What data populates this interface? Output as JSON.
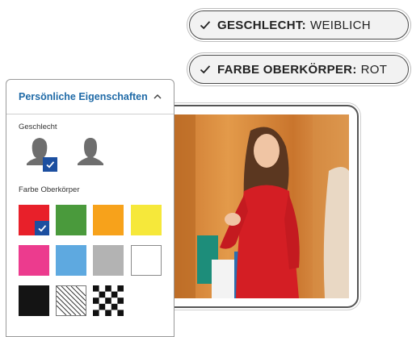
{
  "chips": [
    {
      "key": "GESCHLECHT:",
      "value": "WEIBLICH"
    },
    {
      "key": "FARBE OBERKÖRPER:",
      "value": "ROT"
    }
  ],
  "panel": {
    "title": "Persönliche Eigenschaften",
    "gender_label": "Geschlecht",
    "gender_options": [
      {
        "icon": "female-silhouette-icon",
        "selected": true
      },
      {
        "icon": "male-silhouette-icon",
        "selected": false
      }
    ],
    "color_label": "Farbe Oberkörper",
    "colors": [
      {
        "name": "red",
        "hex": "#e8202a",
        "selected": true
      },
      {
        "name": "green",
        "hex": "#4a9a3c",
        "selected": false
      },
      {
        "name": "orange",
        "hex": "#f7a21b",
        "selected": false
      },
      {
        "name": "yellow",
        "hex": "#f6e83a",
        "selected": false
      },
      {
        "name": "pink",
        "hex": "#ec3b8e",
        "selected": false
      },
      {
        "name": "light-blue",
        "hex": "#5ea9e0",
        "selected": false
      },
      {
        "name": "grey",
        "hex": "#b3b3b3",
        "selected": false
      },
      {
        "name": "white",
        "hex": "#ffffff",
        "selected": false
      },
      {
        "name": "black",
        "hex": "#141414",
        "selected": false
      },
      {
        "name": "striped",
        "hex": "pattern-stripes",
        "selected": false
      },
      {
        "name": "checkered",
        "hex": "pattern-checker",
        "selected": false
      }
    ]
  },
  "accent_color": "#1f6aa7",
  "check_badge_color": "#1c4fa0"
}
